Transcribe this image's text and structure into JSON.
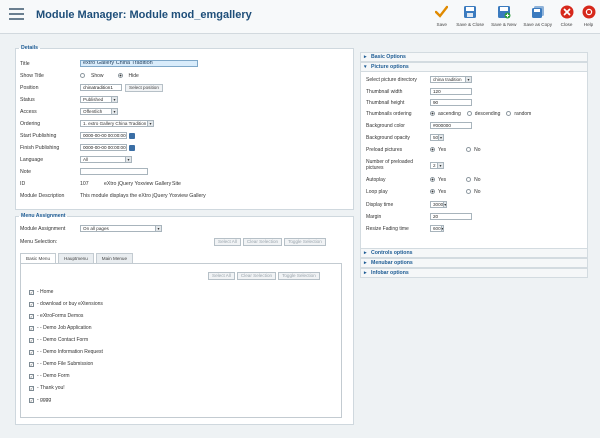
{
  "header": {
    "title": "Module Manager: Module mod_emgallery",
    "toolbar": [
      {
        "name": "save-button",
        "icon": "check-icon",
        "label": "Save",
        "color": "#e08a00"
      },
      {
        "name": "save-close-button",
        "icon": "save-close-icon",
        "label": "Save & Close",
        "color": "#3b7bbf"
      },
      {
        "name": "save-new-button",
        "icon": "save-new-icon",
        "label": "Save & New",
        "color": "#3b7bbf"
      },
      {
        "name": "save-copy-button",
        "icon": "save-copy-icon",
        "label": "Save as Copy",
        "color": "#3b7bbf"
      },
      {
        "name": "close-button",
        "icon": "close-icon",
        "label": "Close",
        "color": "#d6281b"
      },
      {
        "name": "help-button",
        "icon": "help-icon",
        "label": "Help",
        "color": "#d6281b"
      }
    ]
  },
  "details": {
    "legend": "Details",
    "title_label": "Title",
    "title_value": "extro Gallery China Tradition",
    "show_title_label": "Show Title",
    "show_label": "Show",
    "hide_label": "Hide",
    "position_label": "Position",
    "position_value": "chinatradition1",
    "select_position": "Select position",
    "status_label": "Status",
    "status_value": "Published",
    "access_label": "Access",
    "access_value": "Offentlich",
    "ordering_label": "Ordering",
    "ordering_value": "1. extro Gallery China Tradition",
    "start_label": "Start Publishing",
    "start_value": "0000-00-00 00:00:00",
    "finish_label": "Finish Publishing",
    "finish_value": "0000-00-00 00:00:00",
    "language_label": "Language",
    "language_value": "All",
    "note_label": "Note",
    "note_value": "",
    "id_label": "ID",
    "id_value": "107",
    "id_name": "eXtro jQuery Yoxview Gallery",
    "id_site": "Site",
    "desc_label": "Module Description",
    "desc_value": "This module displays the eXtro jQuery Yoxview Gallery"
  },
  "menu_assignment": {
    "legend": "Menu Assignment",
    "assign_label": "Module Assignment",
    "assign_value": "On all pages",
    "selection_label": "Menu Selection:",
    "select_all": "Select All",
    "clear_selection": "Clear Selection",
    "toggle_selection": "Toggle Selection",
    "tabs": [
      "Basic Menu",
      "Hauptmenu",
      "Main Menue"
    ],
    "items": [
      "- Home",
      "- download or buy eXtensions",
      "- eXtroForms Demos",
      "- - Demo Job Application",
      "- - Demo Contact Form",
      "- - Demo Information Request",
      "- - Demo File Submission",
      "- - Demo Form",
      "- Thank you!",
      "- gggg"
    ]
  },
  "options": {
    "basic": "Basic Options",
    "picture": "Picture options",
    "controls": "Controls options",
    "menubar": "Menubar options",
    "infobar": "Infobar options",
    "fields": {
      "dir_label": "Select picture directory",
      "dir_value": "china tradition",
      "thumb_w_label": "Thumbnail width",
      "thumb_w_value": "120",
      "thumb_h_label": "Thumbnail height",
      "thumb_h_value": "90",
      "order_label": "Thumbnails ordering",
      "asc": "ascending",
      "desc": "descending",
      "random": "random",
      "bg_color_label": "Background color",
      "bg_color_value": "#000000",
      "bg_opacity_label": "Background opacity",
      "bg_opacity_value": "50",
      "preload_label": "Preload pictures",
      "yes": "Yes",
      "no": "No",
      "num_preload_label": "Number of preloaded pictures",
      "num_preload_value": "2",
      "autoplay_label": "Autoplay",
      "loop_label": "Loop play",
      "display_label": "Display time",
      "display_value": "3000",
      "margin_label": "Margin",
      "margin_value": "20",
      "fade_label": "Resize Fading time",
      "fade_value": "600"
    }
  }
}
